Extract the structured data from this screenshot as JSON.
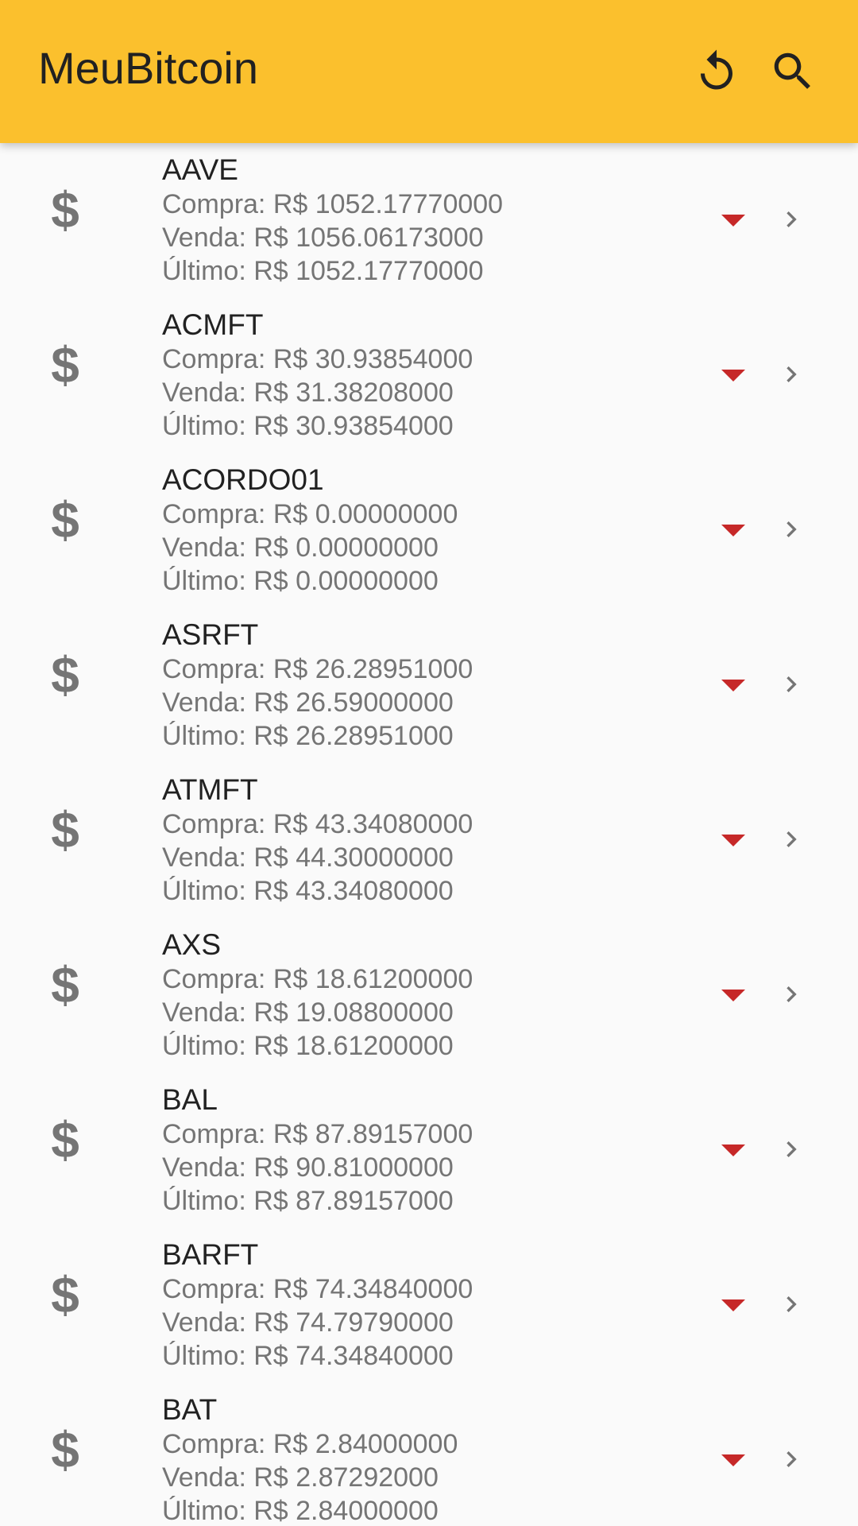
{
  "app_bar": {
    "title": "MeuBitcoin",
    "actions": [
      "refresh-icon",
      "search-icon"
    ]
  },
  "colors": {
    "app_bar": "#fbc02d",
    "trend_down": "#c62828",
    "secondary_text": "#757575"
  },
  "coins": [
    {
      "name": "AAVE",
      "compra": "Compra: R$ 1052.17770000",
      "venda": "Venda: R$ 1056.06173000",
      "ultimo": "Último: R$ 1052.17770000"
    },
    {
      "name": "ACMFT",
      "compra": "Compra: R$ 30.93854000",
      "venda": "Venda: R$ 31.38208000",
      "ultimo": "Último: R$ 30.93854000"
    },
    {
      "name": "ACORDO01",
      "compra": "Compra: R$ 0.00000000",
      "venda": "Venda: R$ 0.00000000",
      "ultimo": "Último: R$ 0.00000000"
    },
    {
      "name": "ASRFT",
      "compra": "Compra: R$ 26.28951000",
      "venda": "Venda: R$ 26.59000000",
      "ultimo": "Último: R$ 26.28951000"
    },
    {
      "name": "ATMFT",
      "compra": "Compra: R$ 43.34080000",
      "venda": "Venda: R$ 44.30000000",
      "ultimo": "Último: R$ 43.34080000"
    },
    {
      "name": "AXS",
      "compra": "Compra: R$ 18.61200000",
      "venda": "Venda: R$ 19.08800000",
      "ultimo": "Último: R$ 18.61200000"
    },
    {
      "name": "BAL",
      "compra": "Compra: R$ 87.89157000",
      "venda": "Venda: R$ 90.81000000",
      "ultimo": "Último: R$ 87.89157000"
    },
    {
      "name": "BARFT",
      "compra": "Compra: R$ 74.34840000",
      "venda": "Venda: R$ 74.79790000",
      "ultimo": "Último: R$ 74.34840000"
    },
    {
      "name": "BAT",
      "compra": "Compra: R$ 2.84000000",
      "venda": "Venda: R$ 2.87292000",
      "ultimo": "Último: R$ 2.84000000"
    }
  ]
}
